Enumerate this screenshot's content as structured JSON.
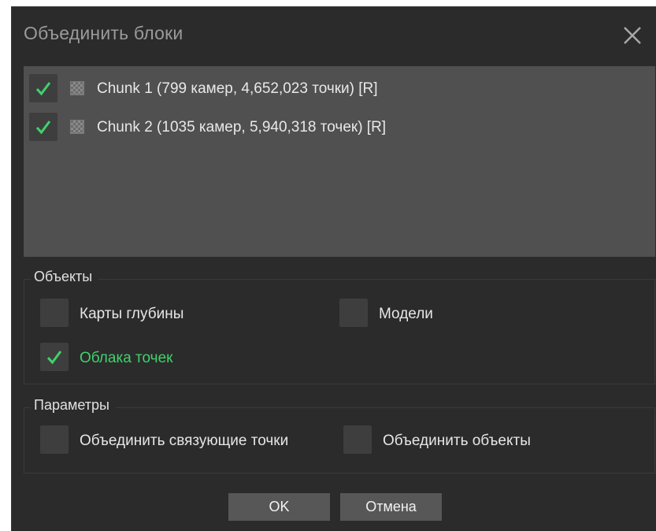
{
  "dialog": {
    "title": "Объединить блоки",
    "close_icon": "close-icon"
  },
  "chunks": [
    {
      "label": "Chunk 1 (799 камер, 4,652,023 точки) [R]",
      "checked": true
    },
    {
      "label": "Chunk 2 (1035 камер, 5,940,318 точек) [R]",
      "checked": true
    }
  ],
  "objects": {
    "title": "Объекты",
    "depth_maps": {
      "label": "Карты глубины",
      "checked": false
    },
    "models": {
      "label": "Модели",
      "checked": false
    },
    "point_clouds": {
      "label": "Облака точек",
      "checked": true
    }
  },
  "params": {
    "title": "Параметры",
    "merge_tie_points": {
      "label": "Объединить связующие точки",
      "checked": false
    },
    "merge_objects": {
      "label": "Объединить объекты",
      "checked": false
    }
  },
  "buttons": {
    "ok": "OK",
    "cancel": "Отмена"
  },
  "colors": {
    "accent_check": "#3fd26b",
    "dialog_bg": "#2b2b2b",
    "list_bg": "#505050"
  }
}
